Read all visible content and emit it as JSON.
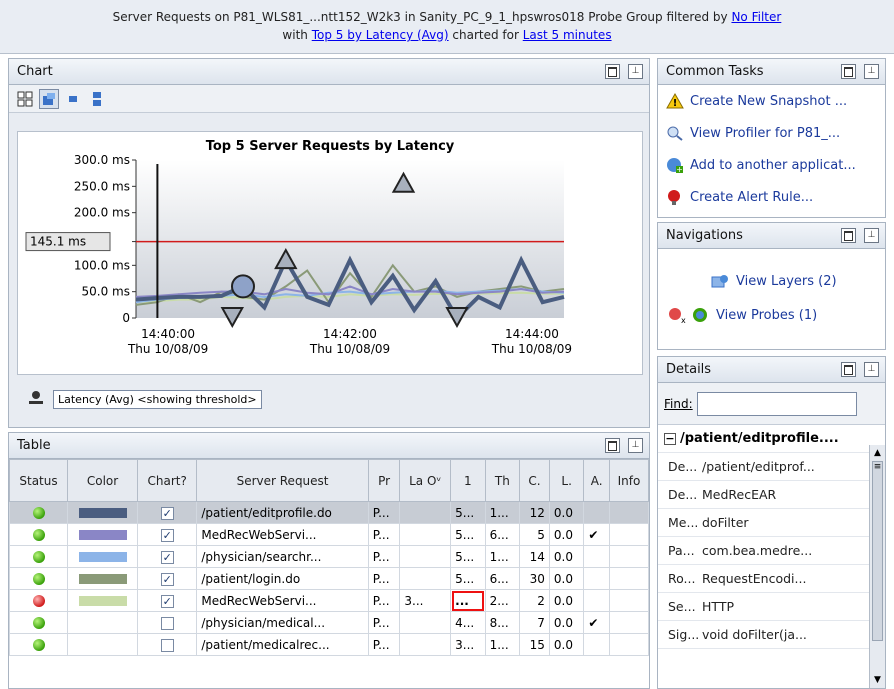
{
  "header": {
    "line1_text": "Server Requests on P81_WLS81_...ntt152_W2k3 in Sanity_PC_9_1_hpswros018 Probe Group filtered by ",
    "filter_link": "No Filter",
    "line2_prefix": "with ",
    "metric_link": "Top 5 by Latency (Avg)",
    "line2_mid": " charted for ",
    "range_link": "Last 5 minutes"
  },
  "chart_panel": {
    "title": "Chart"
  },
  "chart_data": {
    "type": "line",
    "title": "Top 5 Server Requests by Latency",
    "ylabel": "",
    "xlabel": "",
    "ylim": [
      0,
      300
    ],
    "ytick_labels": [
      "300.0 ms",
      "250.0 ms",
      "200.0 ms",
      "145.1 ms",
      "100.0 ms",
      "50.0 ms",
      "0"
    ],
    "yticks": [
      300,
      250,
      200,
      145.1,
      100,
      50,
      0
    ],
    "threshold": 145.1,
    "xtick_labels": [
      {
        "time": "14:40:00",
        "date": "Thu 10/08/09"
      },
      {
        "time": "14:42:00",
        "date": "Thu 10/08/09"
      },
      {
        "time": "14:44:00",
        "date": "Thu 10/08/09"
      }
    ],
    "x": [
      0,
      1,
      2,
      3,
      4,
      5,
      6,
      7,
      8,
      9,
      10,
      11,
      12,
      13,
      14,
      15,
      16,
      17,
      18,
      19,
      20
    ],
    "series": [
      {
        "color": "#4a5d80",
        "values": [
          35,
          38,
          40,
          40,
          42,
          60,
          20,
          110,
          40,
          25,
          110,
          30,
          80,
          15,
          70,
          0,
          40,
          20,
          110,
          30,
          40
        ]
      },
      {
        "color": "#8a86c6",
        "values": [
          40,
          42,
          45,
          48,
          50,
          50,
          45,
          55,
          48,
          45,
          60,
          45,
          55,
          50,
          50,
          45,
          48,
          50,
          55,
          48,
          50
        ]
      },
      {
        "color": "#8cb4e8",
        "values": [
          30,
          35,
          38,
          40,
          42,
          45,
          40,
          45,
          42,
          48,
          50,
          45,
          48,
          50,
          52,
          48,
          50,
          52,
          55,
          50,
          48
        ]
      },
      {
        "color": "#8a9a78",
        "values": [
          25,
          30,
          45,
          30,
          50,
          40,
          35,
          60,
          90,
          30,
          85,
          40,
          100,
          50,
          60,
          40,
          50,
          55,
          60,
          50,
          55
        ]
      },
      {
        "color": "#c9dca8",
        "values": [
          30,
          32,
          35,
          35,
          40,
          38,
          35,
          40,
          42,
          40,
          45,
          42,
          45,
          44,
          46,
          45,
          46,
          47,
          48,
          46,
          46
        ]
      }
    ]
  },
  "legend": {
    "label": "Latency (Avg) <showing threshold>"
  },
  "table_panel": {
    "title": "Table"
  },
  "table": {
    "headers": [
      "Status",
      "Color",
      "Chart?",
      "Server Request",
      "Pr",
      "La Oᵛ",
      "1",
      "Th",
      "C.",
      "L.",
      "A.",
      "Info"
    ],
    "rows": [
      {
        "status": "green",
        "color": "#4a5d80",
        "chart": true,
        "request": "/patient/editprofile.do",
        "pr": "P...",
        "la": "",
        "one": "5...",
        "th": "1...",
        "c": "12",
        "l": "0.0",
        "a": "",
        "info": "",
        "selected": true
      },
      {
        "status": "green",
        "color": "#8a86c6",
        "chart": true,
        "request": "MedRecWebServi...",
        "pr": "P...",
        "la": "",
        "one": "5...",
        "th": "6...",
        "c": "5",
        "l": "0.0",
        "a": "✔",
        "info": ""
      },
      {
        "status": "green",
        "color": "#8cb4e8",
        "chart": true,
        "request": "/physician/searchr...",
        "pr": "P...",
        "la": "",
        "one": "5...",
        "th": "1...",
        "c": "14",
        "l": "0.0",
        "a": "",
        "info": ""
      },
      {
        "status": "green",
        "color": "#8a9a78",
        "chart": true,
        "request": "/patient/login.do",
        "pr": "P...",
        "la": "",
        "one": "5...",
        "th": "6...",
        "c": "30",
        "l": "0.0",
        "a": "",
        "info": ""
      },
      {
        "status": "red",
        "color": "#c9dca8",
        "chart": true,
        "request": "MedRecWebServi...",
        "pr": "P...",
        "la": "3...",
        "one": "...",
        "th": "2...",
        "c": "2",
        "l": "0.0",
        "a": "",
        "info": ""
      },
      {
        "status": "green",
        "color": "",
        "chart": false,
        "request": "/physician/medical...",
        "pr": "P...",
        "la": "",
        "one": "4...",
        "th": "8...",
        "c": "7",
        "l": "0.0",
        "a": "✔",
        "info": ""
      },
      {
        "status": "green",
        "color": "",
        "chart": false,
        "request": "/patient/medicalrec...",
        "pr": "P...",
        "la": "",
        "one": "3...",
        "th": "1...",
        "c": "15",
        "l": "0.0",
        "a": "",
        "info": ""
      }
    ]
  },
  "tasks_panel": {
    "title": "Common Tasks",
    "items": [
      {
        "label": "Create New Snapshot ...",
        "icon": "warning-icon"
      },
      {
        "label": "View Profiler for P81_...",
        "icon": "profiler-icon"
      },
      {
        "label": "Add to another applicat...",
        "icon": "add-app-icon"
      },
      {
        "label": "Create Alert Rule...",
        "icon": "alert-icon"
      }
    ]
  },
  "nav_panel": {
    "title": "Navigations",
    "layers_label": "View Layers (2)",
    "probes_label": "View Probes (1)"
  },
  "details_panel": {
    "title": "Details",
    "find_label": "Find:",
    "find_value": "",
    "node_label": "/patient/editprofile....",
    "rows": [
      {
        "key": "De...",
        "value": "/patient/editprof..."
      },
      {
        "key": "De...",
        "value": "MedRecEAR"
      },
      {
        "key": "Me...",
        "value": "doFilter"
      },
      {
        "key": "Pa...",
        "value": "com.bea.medre..."
      },
      {
        "key": "Ro...",
        "value": "RequestEncodi..."
      },
      {
        "key": "Se...",
        "value": "HTTP"
      },
      {
        "key": "Sig...",
        "value": "void doFilter(ja..."
      }
    ]
  }
}
